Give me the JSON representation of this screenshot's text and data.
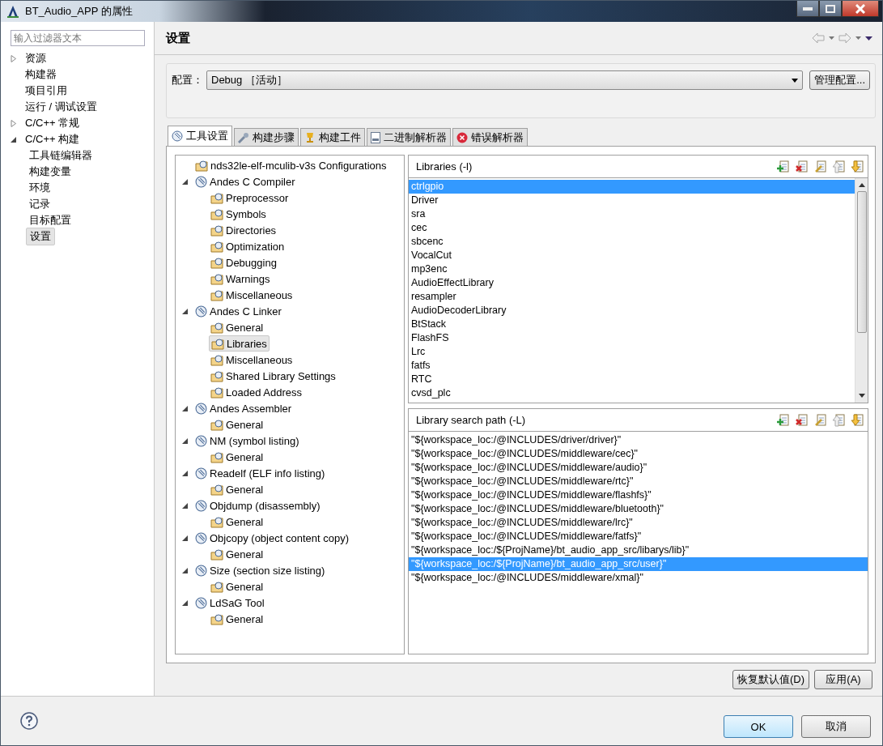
{
  "window": {
    "title": "BT_Audio_APP 的属性"
  },
  "sidebar": {
    "filter": {
      "placeholder": "输入过滤器文本"
    },
    "items": [
      {
        "label": "资源",
        "expanded": false,
        "selected": false
      },
      {
        "label": "构建器",
        "selected": false
      },
      {
        "label": "项目引用",
        "selected": false
      },
      {
        "label": "运行 / 调试设置",
        "selected": false
      },
      {
        "label": "C/C++ 常规",
        "expanded": false,
        "selected": false
      },
      {
        "label": "C/C++ 构建",
        "expanded": true,
        "selected": false,
        "children": [
          {
            "label": "工具链编辑器",
            "selected": false
          },
          {
            "label": "构建变量",
            "selected": false
          },
          {
            "label": "环境",
            "selected": false
          },
          {
            "label": "记录",
            "selected": false
          },
          {
            "label": "目标配置",
            "selected": false
          },
          {
            "label": "设置",
            "selected": true
          }
        ]
      }
    ]
  },
  "page": {
    "title": "设置"
  },
  "configuration": {
    "label": "配置：",
    "value": "Debug ［活动］",
    "manage_button": "管理配置..."
  },
  "tabs": [
    {
      "label": "工具设置",
      "kind": "tool",
      "selected": true
    },
    {
      "label": "构建步骤",
      "kind": "steps",
      "selected": false
    },
    {
      "label": "构建工件",
      "kind": "artifact",
      "selected": false
    },
    {
      "label": "二进制解析器",
      "kind": "binary",
      "selected": false
    },
    {
      "label": "错误解析器",
      "kind": "error",
      "selected": false
    }
  ],
  "tool_tree": [
    {
      "label": "nds32le-elf-mculib-v3s Configurations",
      "kind": "category",
      "selected": false
    },
    {
      "label": "Andes C Compiler",
      "kind": "tool",
      "expanded": true,
      "selected": false,
      "children": [
        {
          "label": "Preprocessor",
          "kind": "category",
          "selected": false
        },
        {
          "label": "Symbols",
          "kind": "category",
          "selected": false
        },
        {
          "label": "Directories",
          "kind": "category",
          "selected": false
        },
        {
          "label": "Optimization",
          "kind": "category",
          "selected": false
        },
        {
          "label": "Debugging",
          "kind": "category",
          "selected": false
        },
        {
          "label": "Warnings",
          "kind": "category",
          "selected": false
        },
        {
          "label": "Miscellaneous",
          "kind": "category",
          "selected": false
        }
      ]
    },
    {
      "label": "Andes C Linker",
      "kind": "tool",
      "expanded": true,
      "selected": false,
      "children": [
        {
          "label": "General",
          "kind": "category",
          "selected": false
        },
        {
          "label": "Libraries",
          "kind": "category",
          "selected": true
        },
        {
          "label": "Miscellaneous",
          "kind": "category",
          "selected": false
        },
        {
          "label": "Shared Library Settings",
          "kind": "category",
          "selected": false
        },
        {
          "label": "Loaded Address",
          "kind": "category",
          "selected": false
        }
      ]
    },
    {
      "label": "Andes Assembler",
      "kind": "tool",
      "expanded": true,
      "selected": false,
      "children": [
        {
          "label": "General",
          "kind": "category",
          "selected": false
        }
      ]
    },
    {
      "label": "NM (symbol listing)",
      "kind": "tool",
      "expanded": true,
      "selected": false,
      "children": [
        {
          "label": "General",
          "kind": "category",
          "selected": false
        }
      ]
    },
    {
      "label": "Readelf (ELF info listing)",
      "kind": "tool",
      "expanded": true,
      "selected": false,
      "children": [
        {
          "label": "General",
          "kind": "category",
          "selected": false
        }
      ]
    },
    {
      "label": "Objdump (disassembly)",
      "kind": "tool",
      "expanded": true,
      "selected": false,
      "children": [
        {
          "label": "General",
          "kind": "category",
          "selected": false
        }
      ]
    },
    {
      "label": "Objcopy (object content copy)",
      "kind": "tool",
      "expanded": true,
      "selected": false,
      "children": [
        {
          "label": "General",
          "kind": "category",
          "selected": false
        }
      ]
    },
    {
      "label": "Size (section size listing)",
      "kind": "tool",
      "expanded": true,
      "selected": false,
      "children": [
        {
          "label": "General",
          "kind": "category",
          "selected": false
        }
      ]
    },
    {
      "label": "LdSaG Tool",
      "kind": "tool",
      "expanded": true,
      "selected": false,
      "children": [
        {
          "label": "General",
          "kind": "category",
          "selected": false
        }
      ]
    }
  ],
  "lists": [
    {
      "title": "Libraries (-l)",
      "scrollbar": true,
      "items": [
        {
          "text": "ctrlgpio",
          "selected": true
        },
        {
          "text": "Driver",
          "selected": false
        },
        {
          "text": "sra",
          "selected": false
        },
        {
          "text": "cec",
          "selected": false
        },
        {
          "text": "sbcenc",
          "selected": false
        },
        {
          "text": "VocalCut",
          "selected": false
        },
        {
          "text": "mp3enc",
          "selected": false
        },
        {
          "text": "AudioEffectLibrary",
          "selected": false
        },
        {
          "text": "resampler",
          "selected": false
        },
        {
          "text": "AudioDecoderLibrary",
          "selected": false
        },
        {
          "text": "BtStack",
          "selected": false
        },
        {
          "text": "FlashFS",
          "selected": false
        },
        {
          "text": "Lrc",
          "selected": false
        },
        {
          "text": "fatfs",
          "selected": false
        },
        {
          "text": "RTC",
          "selected": false
        },
        {
          "text": "cvsd_plc",
          "selected": false
        }
      ]
    },
    {
      "title": "Library search path (-L)",
      "scrollbar": false,
      "items": [
        {
          "text": "\"${workspace_loc:/@INCLUDES/driver/driver}\"",
          "selected": false
        },
        {
          "text": "\"${workspace_loc:/@INCLUDES/middleware/cec}\"",
          "selected": false
        },
        {
          "text": "\"${workspace_loc:/@INCLUDES/middleware/audio}\"",
          "selected": false
        },
        {
          "text": "\"${workspace_loc:/@INCLUDES/middleware/rtc}\"",
          "selected": false
        },
        {
          "text": "\"${workspace_loc:/@INCLUDES/middleware/flashfs}\"",
          "selected": false
        },
        {
          "text": "\"${workspace_loc:/@INCLUDES/middleware/bluetooth}\"",
          "selected": false
        },
        {
          "text": "\"${workspace_loc:/@INCLUDES/middleware/lrc}\"",
          "selected": false
        },
        {
          "text": "\"${workspace_loc:/@INCLUDES/middleware/fatfs}\"",
          "selected": false
        },
        {
          "text": "\"${workspace_loc:/${ProjName}/bt_audio_app_src/libarys/lib}\"",
          "selected": false
        },
        {
          "text": "\"${workspace_loc:/${ProjName}/bt_audio_app_src/user}\"",
          "selected": true
        },
        {
          "text": "\"${workspace_loc:/@INCLUDES/middleware/xmal}\"",
          "selected": false
        }
      ]
    }
  ],
  "buttons": {
    "restore": "恢复默认值(D)",
    "apply": "应用(A)",
    "ok": "OK",
    "cancel": "取消"
  }
}
